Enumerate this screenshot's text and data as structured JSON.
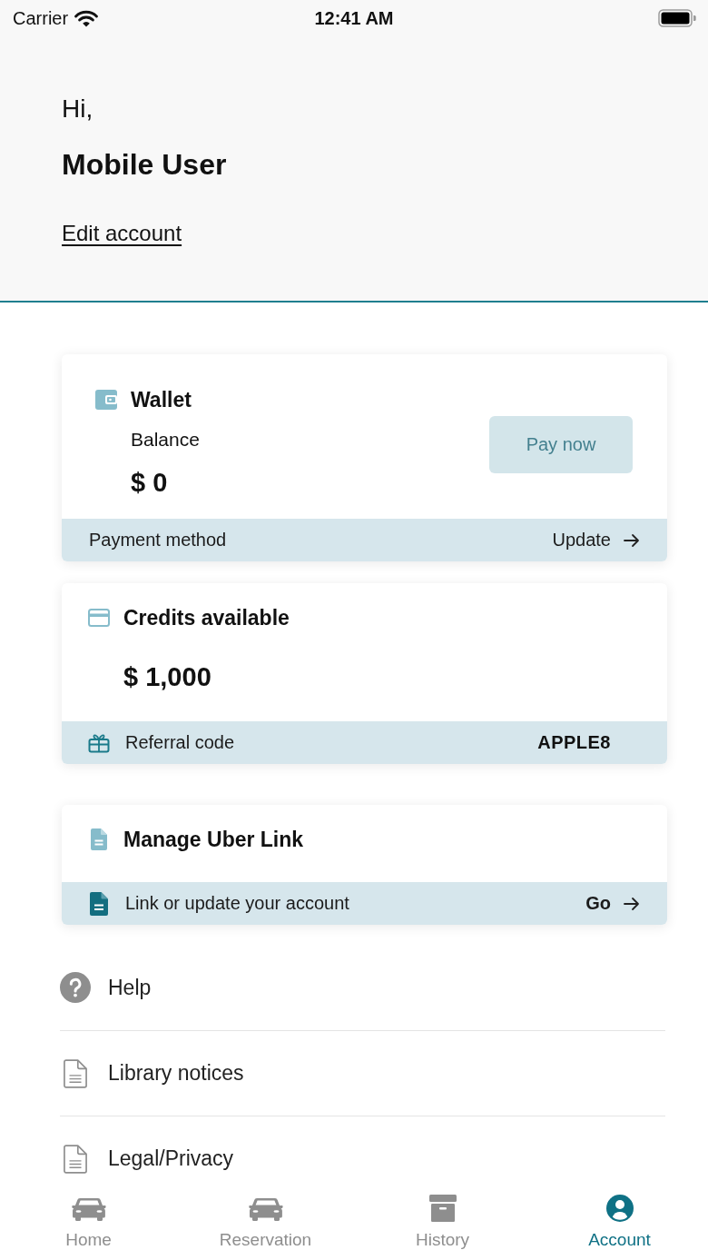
{
  "status_bar": {
    "carrier": "Carrier",
    "time": "12:41 AM"
  },
  "header": {
    "greeting": "Hi,",
    "name": "Mobile User",
    "edit_link": "Edit account"
  },
  "wallet_card": {
    "title": "Wallet",
    "balance_label": "Balance",
    "balance": "$ 0",
    "pay_button": {
      "label": "Pay now",
      "disabled": true
    },
    "footer": {
      "label": "Payment method",
      "action": "Update"
    }
  },
  "credits_card": {
    "title": "Credits available",
    "amount": "$ 1,000",
    "footer": {
      "label": "Referral code",
      "code": "APPLE8"
    }
  },
  "link_card": {
    "title": "Manage Uber Link",
    "footer": {
      "label": "Link or update your account",
      "action": "Go"
    }
  },
  "menu": [
    {
      "label": "Help",
      "kind": "help"
    },
    {
      "label": "Library notices",
      "kind": "document"
    },
    {
      "label": "Legal/Privacy",
      "kind": "document"
    }
  ],
  "tab_bar": [
    {
      "label": "Home",
      "kind": "car",
      "selected": false
    },
    {
      "label": "Reservation",
      "kind": "car",
      "selected": false
    },
    {
      "label": "History",
      "kind": "archive",
      "selected": false
    },
    {
      "label": "Account",
      "kind": "person",
      "selected": true
    }
  ]
}
